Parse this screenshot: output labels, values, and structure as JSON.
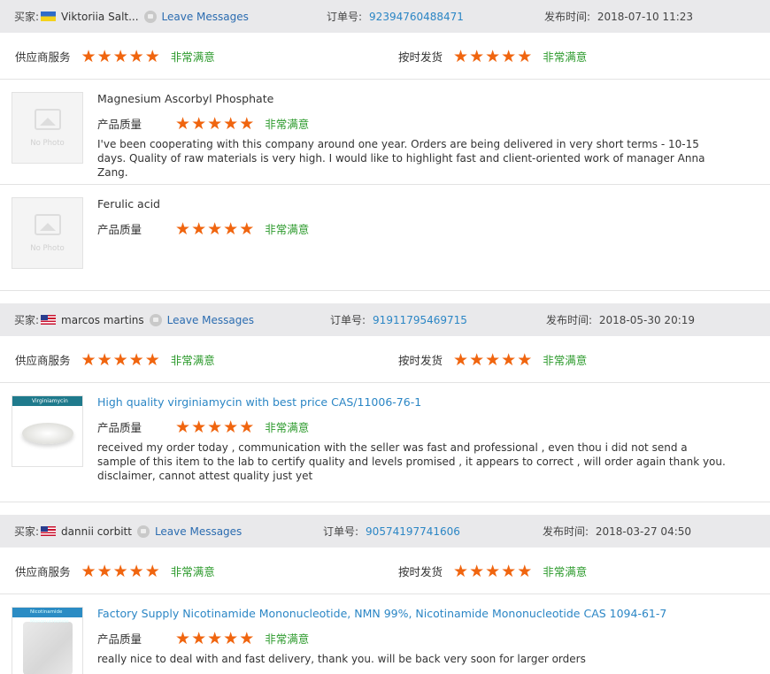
{
  "labels": {
    "buyer": "买家:",
    "leave_messages": "Leave Messages",
    "order_no": "订单号:",
    "posted_time": "发布时间:",
    "supplier_service": "供应商服务",
    "on_time_delivery": "按时发货",
    "product_quality": "产品质量",
    "very_satisfied": "非常满意",
    "no_photo": "No Photo"
  },
  "colors": {
    "star": "#f0650f",
    "satisfied": "#2c9a2c",
    "link": "#2b86c5",
    "header_bg": "#e9e9eb"
  },
  "reviews": [
    {
      "buyer_name": "Viktoriia Salt...",
      "flag": "ukraine-flag-icon",
      "order_number": "92394760488471",
      "date": "2018-07-10 11:23",
      "service_rating": 5,
      "delivery_rating": 5,
      "products": [
        {
          "name": "Magnesium Ascorbyl Phosphate",
          "quality_rating": 5,
          "comment": "I've been cooperating with this company around one year. Orders are being delivered in very short terms - 10-15 days. Quality of raw materials is very high. I would like to highlight fast and client-oriented work of manager Anna Zang."
        },
        {
          "name": "Ferulic acid",
          "quality_rating": 5,
          "comment": ""
        }
      ]
    },
    {
      "buyer_name": "marcos martins",
      "flag": "usa-flag-icon",
      "order_number": "91911795469715",
      "date": "2018-05-30 20:19",
      "service_rating": 5,
      "delivery_rating": 5,
      "products": [
        {
          "name": "High quality virginiamycin with best price CAS/11006-76-1",
          "image_label": "Virginiamycin",
          "quality_rating": 5,
          "comment": "received my order today , communication with the seller was fast and professional , even thou i did not send a sample of this item to the lab to certify quality and levels promised , it appears to correct , will order again thank you. disclaimer, cannot attest quality just yet"
        }
      ]
    },
    {
      "buyer_name": "dannii corbitt",
      "flag": "usa-flag-icon",
      "order_number": "90574197741606",
      "date": "2018-03-27 04:50",
      "service_rating": 5,
      "delivery_rating": 5,
      "products": [
        {
          "name": "Factory Supply Nicotinamide Mononucleotide, NMN 99%, Nicotinamide Mononucleotide CAS 1094-61-7",
          "image_label": "Nicotinamide Mononucleotide",
          "quality_rating": 5,
          "comment": "really nice to deal with and fast delivery, thank you. will be back very soon for larger orders"
        }
      ]
    }
  ]
}
